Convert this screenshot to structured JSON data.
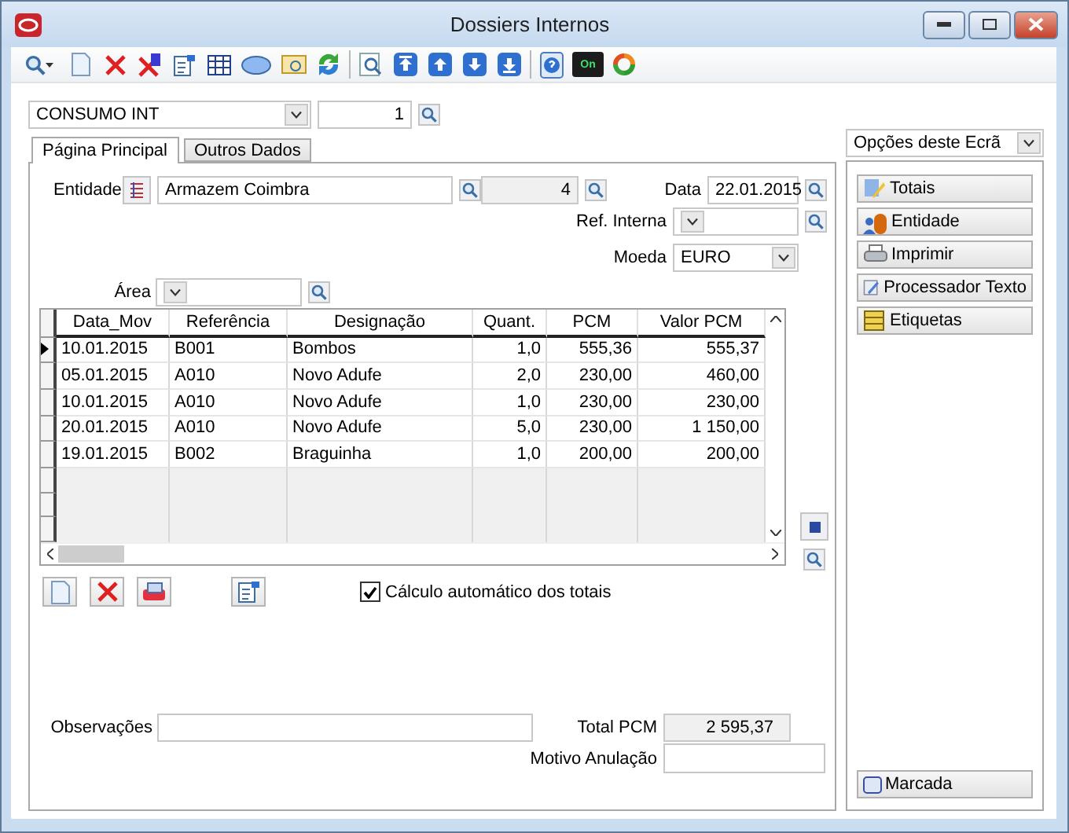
{
  "window": {
    "title": "Dossiers Internos"
  },
  "toolbar": {
    "status_badge": "On"
  },
  "document_type": {
    "value": "CONSUMO INT"
  },
  "document_number": "1",
  "tabs": [
    {
      "label": "Página Principal",
      "selected": true
    },
    {
      "label": "Outros Dados",
      "selected": false
    }
  ],
  "entidade": {
    "label": "Entidade",
    "name": "Armazem Coimbra",
    "code": "4"
  },
  "data": {
    "label": "Data",
    "value": "22.01.2015"
  },
  "ref_interna": {
    "label": "Ref. Interna"
  },
  "moeda": {
    "label": "Moeda",
    "value": "EURO"
  },
  "area": {
    "label": "Área"
  },
  "table": {
    "columns": [
      "Data_Mov",
      "Referência",
      "Designação",
      "Quant.",
      "PCM",
      "Valor PCM"
    ],
    "rows": [
      {
        "selected": true,
        "cells": [
          "10.01.2015",
          "B001",
          "Bombos",
          "1,0",
          "555,36",
          "555,37"
        ]
      },
      {
        "selected": false,
        "cells": [
          "05.01.2015",
          "A010",
          "Novo Adufe",
          "2,0",
          "230,00",
          "460,00"
        ]
      },
      {
        "selected": false,
        "cells": [
          "10.01.2015",
          "A010",
          "Novo Adufe",
          "1,0",
          "230,00",
          "230,00"
        ]
      },
      {
        "selected": false,
        "cells": [
          "20.01.2015",
          "A010",
          "Novo Adufe",
          "5,0",
          "230,00",
          "1 150,00"
        ]
      },
      {
        "selected": false,
        "cells": [
          "19.01.2015",
          "B002",
          "Braguinha",
          "1,0",
          "200,00",
          "200,00"
        ]
      }
    ]
  },
  "auto_totals": {
    "label": "Cálculo automático dos totais",
    "checked": true
  },
  "observacoes": {
    "label": "Observações"
  },
  "total_pcm": {
    "label": "Total PCM",
    "value": "2 595,37"
  },
  "motivo_anulacao": {
    "label": "Motivo Anulação"
  },
  "side_panel": {
    "title": "Opções deste Ecrã",
    "buttons": [
      {
        "label": "Totais"
      },
      {
        "label": "Entidade"
      },
      {
        "label": "Imprimir"
      },
      {
        "label": "Processador Texto"
      },
      {
        "label": "Etiquetas"
      }
    ],
    "bottom_button": {
      "label": "Marcada"
    }
  }
}
